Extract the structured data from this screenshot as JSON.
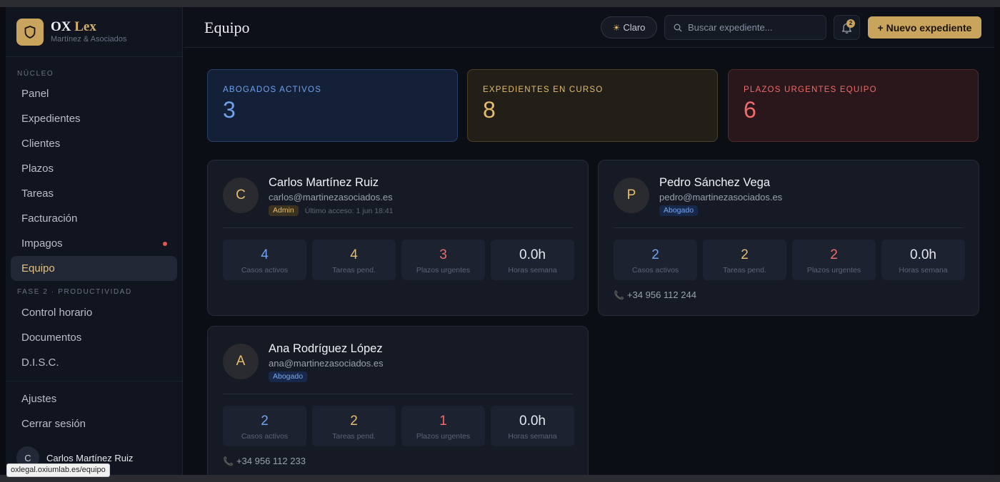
{
  "brand": {
    "name_part1": "OX",
    "name_part2": "Lex",
    "subtitle": "Martínez & Asociados"
  },
  "sidebar": {
    "section1": "NÚCLEO",
    "items1": [
      {
        "label": "Panel"
      },
      {
        "label": "Expedientes"
      },
      {
        "label": "Clientes"
      },
      {
        "label": "Plazos"
      },
      {
        "label": "Tareas"
      },
      {
        "label": "Facturación"
      },
      {
        "label": "Impagos"
      },
      {
        "label": "Equipo"
      }
    ],
    "section2": "FASE 2 · PRODUCTIVIDAD",
    "items2": [
      {
        "label": "Control horario"
      },
      {
        "label": "Documentos"
      },
      {
        "label": "D.I.S.C."
      }
    ],
    "items3": [
      {
        "label": "Ajustes"
      },
      {
        "label": "Cerrar sesión"
      }
    ],
    "active": "Equipo",
    "user": {
      "initial": "C",
      "name": "Carlos Martínez Ruiz"
    }
  },
  "url_tooltip": "oxlegal.oxiumlab.es/equipo",
  "header": {
    "title": "Equipo",
    "theme_label": "Claro",
    "search_placeholder": "Buscar expediente...",
    "notifications_count": "2",
    "new_button": "+ Nuevo expediente"
  },
  "stats": [
    {
      "label": "ABOGADOS ACTIVOS",
      "value": "3",
      "color": "#6ea2ef"
    },
    {
      "label": "EXPEDIENTES EN CURSO",
      "value": "8",
      "color": "#e5bd6b"
    },
    {
      "label": "PLAZOS URGENTES EQUIPO",
      "value": "6",
      "color": "#ef6b6b"
    }
  ],
  "metric_labels": [
    "Casos activos",
    "Tareas pend.",
    "Plazos urgentes",
    "Horas semana"
  ],
  "members": [
    {
      "initial": "C",
      "name": "Carlos Martínez Ruiz",
      "email": "carlos@martinezasociados.es",
      "role": "Admin",
      "last_access": "Último acceso: 1 jun 18:41",
      "metrics": [
        "4",
        "4",
        "3",
        "0.0h"
      ],
      "phone": ""
    },
    {
      "initial": "P",
      "name": "Pedro Sánchez Vega",
      "email": "pedro@martinezasociados.es",
      "role": "Abogado",
      "last_access": "",
      "metrics": [
        "2",
        "2",
        "2",
        "0.0h"
      ],
      "phone": "+34 956 112 244"
    },
    {
      "initial": "A",
      "name": "Ana Rodríguez López",
      "email": "ana@martinezasociados.es",
      "role": "Abogado",
      "last_access": "",
      "metrics": [
        "2",
        "2",
        "1",
        "0.0h"
      ],
      "phone": "+34 956 112 233"
    }
  ]
}
